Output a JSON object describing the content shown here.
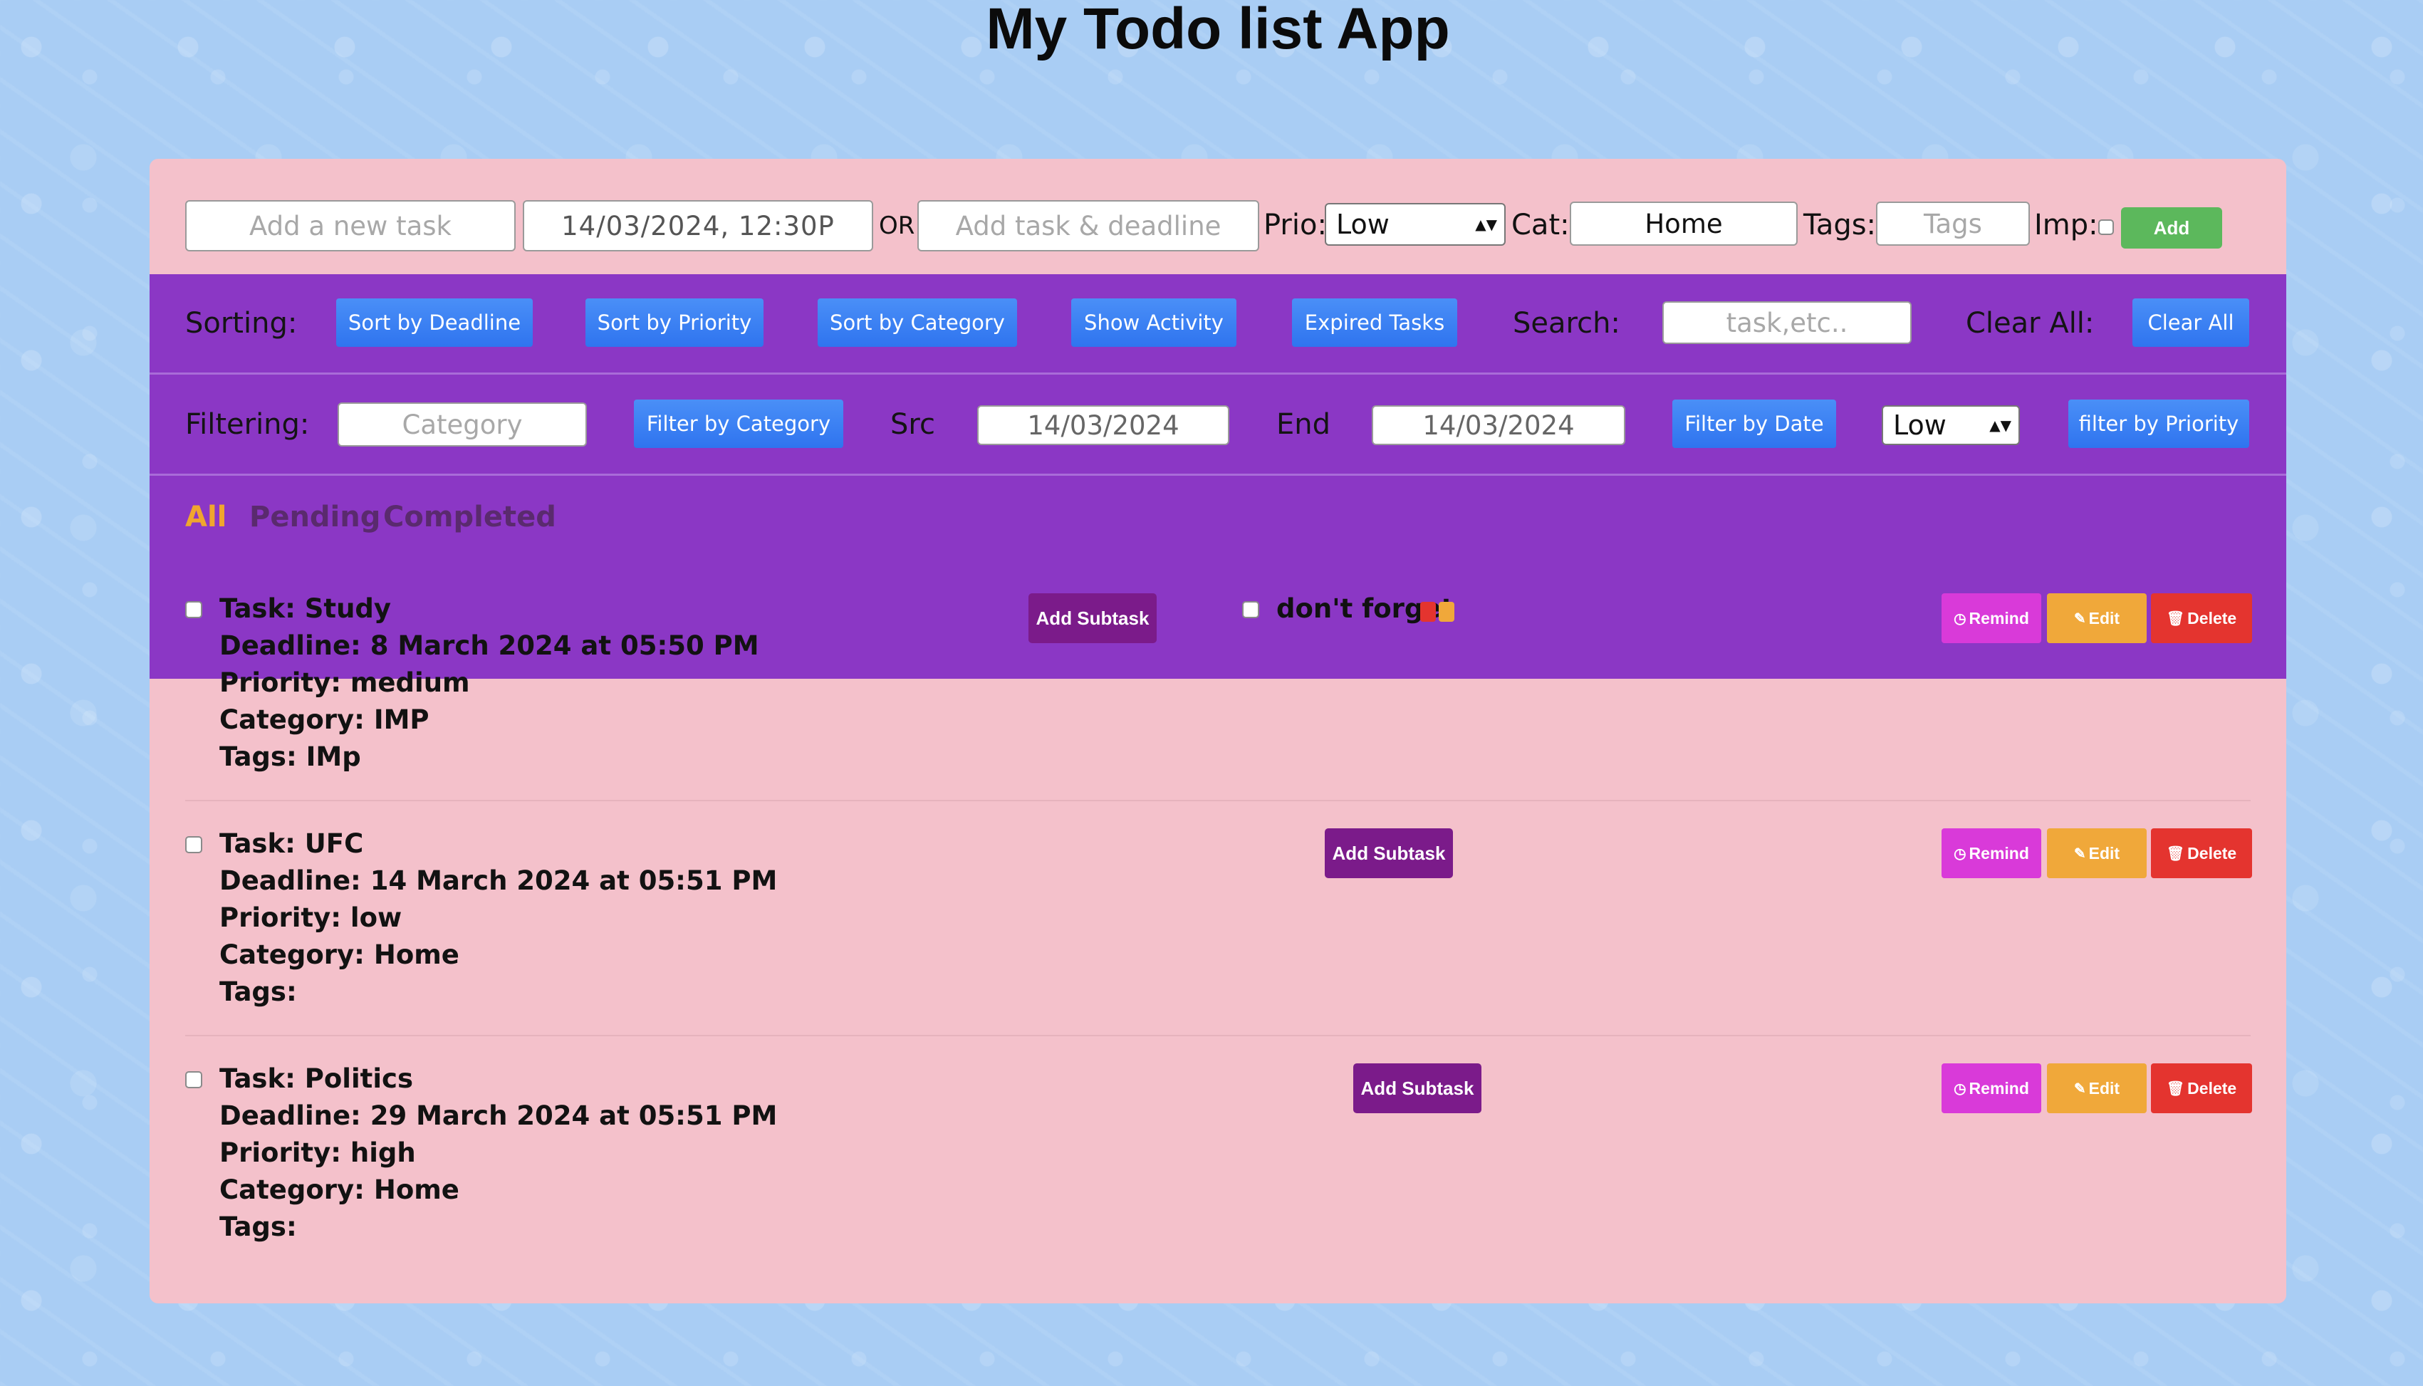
{
  "app": {
    "title": "My Todo list App"
  },
  "add_bar": {
    "task_placeholder": "Add a new task",
    "datetime_value": "14/03/2024, 12:30P",
    "or_label": "OR",
    "smart_placeholder": "Add task & deadline",
    "prio_label": "Prio:",
    "prio_value": "Low",
    "cat_label": "Cat:",
    "cat_value": "Home",
    "tags_label": "Tags:",
    "tags_placeholder": "Tags",
    "imp_label": "Imp:",
    "add_label": "Add"
  },
  "sorting": {
    "label": "Sorting:",
    "buttons": [
      "Sort by Deadline",
      "Sort by Priority",
      "Sort by Category",
      "Show Activity",
      "Expired Tasks"
    ],
    "search_label": "Search:",
    "search_placeholder": "task,etc..",
    "clear_label": "Clear All:",
    "clear_button": "Clear All"
  },
  "filtering": {
    "label": "Filtering:",
    "category_placeholder": "Category",
    "filter_category_button": "Filter by Category",
    "src_label": "Src",
    "src_date": "14/03/2024",
    "end_label": "End",
    "end_date": "14/03/2024",
    "filter_date_button": "Filter by Date",
    "priority_value": "Low",
    "filter_priority_button": "filter by Priority"
  },
  "tabs": {
    "all": "All",
    "pending": "Pending",
    "completed": "Completed",
    "active": "All"
  },
  "colors": {
    "active_tab": "#f0a62e",
    "inactive_tab": "#5a2a6e",
    "band": "#8b37c5",
    "panel": "#f4c1cb"
  },
  "task_actions": {
    "subtask": "Add Subtask",
    "remind": "Remind",
    "edit": "Edit",
    "delete": "Delete"
  },
  "tasks": [
    {
      "task": "Task: Study",
      "deadline": "Deadline: 8 March 2024 at 05:50 PM",
      "priority": "Priority: medium",
      "category": "Category: IMP",
      "tags": "Tags: IMp",
      "subtask": "don't forget"
    },
    {
      "task": "Task: UFC",
      "deadline": "Deadline: 14 March 2024 at 05:51 PM",
      "priority": "Priority: low",
      "category": "Category: Home",
      "tags": "Tags:"
    },
    {
      "task": "Task: Politics",
      "deadline": "Deadline: 29 March 2024 at 05:51 PM",
      "priority": "Priority: high",
      "category": "Category: Home",
      "tags": "Tags:"
    }
  ]
}
